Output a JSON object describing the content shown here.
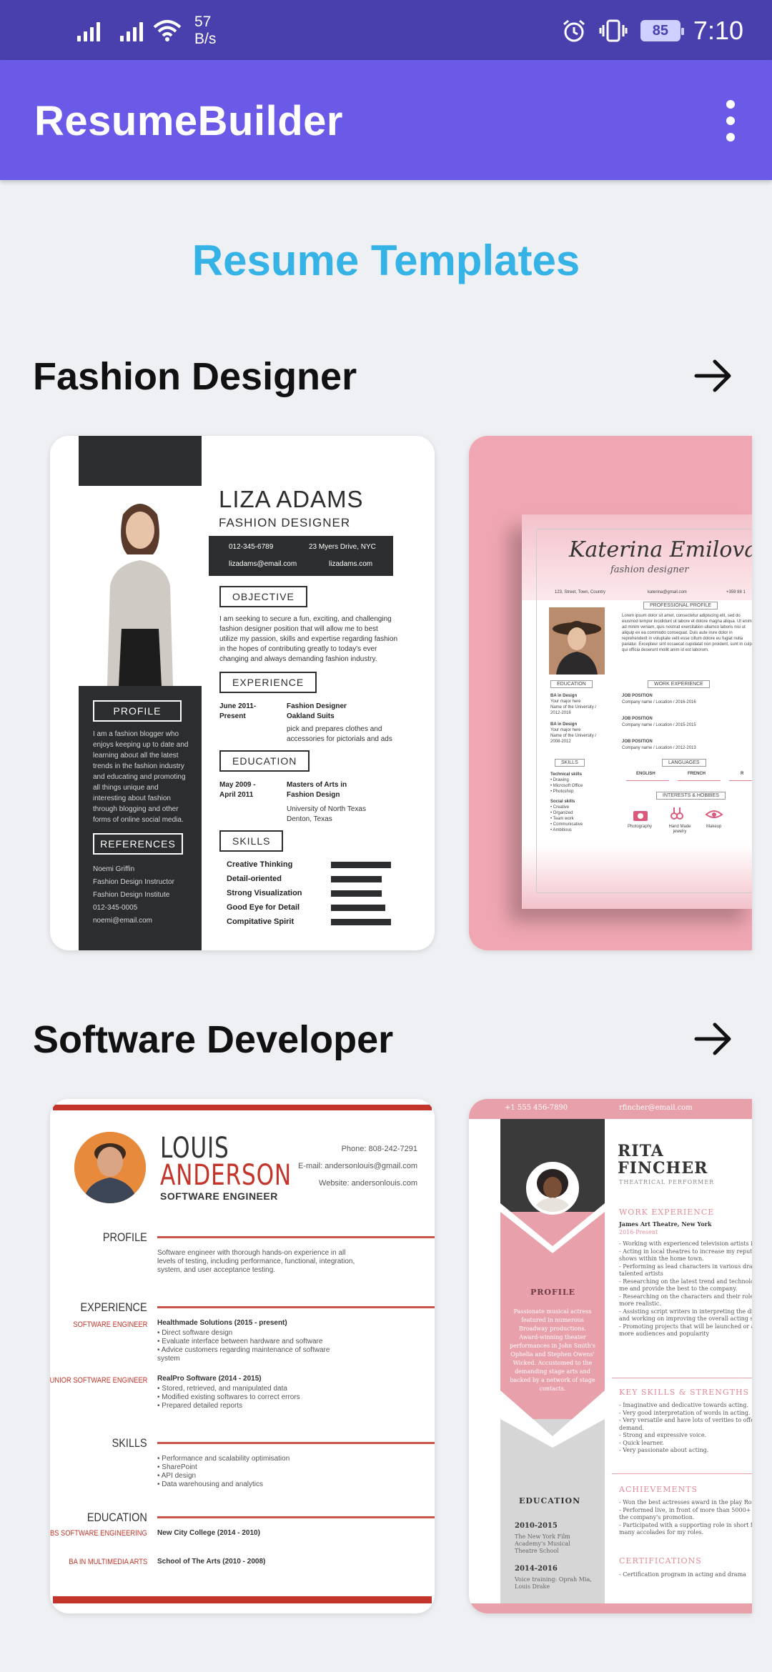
{
  "status_bar": {
    "net_speed_value": "57",
    "net_speed_unit": "B/s",
    "battery": "85",
    "time": "7:10"
  },
  "app_bar": {
    "title": "ResumeBuilder",
    "menu_icon": "more-vert-icon"
  },
  "page_heading": "Resume Templates",
  "accent_colors": {
    "status_bar": "#4a40ad",
    "app_bar": "#6b5ae8",
    "heading": "#35b3e6"
  },
  "sections": [
    {
      "title": "Fashion Designer",
      "arrow_icon": "arrow-right-icon",
      "templates": [
        {
          "name": "LIZA ADAMS",
          "role": "FASHION DESIGNER",
          "phone": "012-345-6789",
          "address": "23 Myers Drive, NYC",
          "email": "lizadams@email.com",
          "website": "lizadams.com",
          "objective_h": "OBJECTIVE",
          "objective": "I am seeking to secure a fun, exciting, and challenging fashion designer position that will allow me to best utilize my passion, skills and expertise regarding fashion in the hopes of contributing greatly to today's ever changing and always demanding fashion industry.",
          "experience_h": "EXPERIENCE",
          "exp_date": "June 2011-\nPresent",
          "exp_title": "Fashion Designer\nOakland Suits",
          "exp_desc": "pick and prepares clothes and accessories for pictorials and ads",
          "education_h": "EDUCATION",
          "edu_date": "May 2009 -\nApril 2011",
          "edu_title": "Masters of  Arts in\nFashion Design",
          "edu_school": "University of North Texas\nDenton, Texas",
          "skills_h": "SKILLS",
          "skills": [
            "Creative Thinking",
            "Detail-oriented",
            "Strong Visualization",
            "Good Eye for Detail",
            "Compitative Spirit"
          ],
          "skill_levels": [
            1.0,
            0.85,
            0.85,
            0.9,
            1.0
          ],
          "profile_h": "PROFILE",
          "profile": "I am a fashion blogger who enjoys keeping up to date and learning about all the latest trends in the fashion industry and educating and promoting all things unique and interesting about fashion through blogging and other forms of online social media.",
          "references_h": "REFERENCES",
          "references": [
            "Noemi Griffin",
            "Fashion Design Instructor",
            "Fashion Design Institute",
            "012-345-0005",
            "noemi@email.com"
          ]
        },
        {
          "name": "Katerina Emilova",
          "role": "fashion designer",
          "address": "123, Street, Town, Country",
          "email": "katerina@gmail.com",
          "phone": "+359 88 1",
          "profile_h": "PROFESSIONAL PROFILE",
          "profile": "Lorem ipsum dolor sit amet, consectetur adipiscing elit, sed do eiusmod tempor incididunt ut labore et dolore magna aliqua. Ut enim ad minim veniam, quis nostrud exercitation ullamco laboris nisi ut aliquip ex ea commodo consequat. Duis aute irure dolor in reprehenderit in voluptate velit esse cillum dolore eu fugiat nulla pariatur. Excepteur sint occaecat cupidatat non proident, sunt in culpa qui officia deserunt mollit anim id est laborum.",
          "education_h": "EDUCATION",
          "education": [
            "BA in Design",
            "Your major here",
            "Name of the University /",
            "2012-2016",
            "BA in Design",
            "Your major here",
            "Name of the University /",
            "2008-2012"
          ],
          "work_h": "WORK EXPERIENCE",
          "jobs": [
            "JOB POSITION",
            "Company name / Location / 2016-2016",
            "JOB POSITION",
            "Company name / Location / 2015-2015",
            "JOB POSITION",
            "Company name / Location / 2012-2013"
          ],
          "skills_h": "SKILLS",
          "tech_h": "Technical skills",
          "tech": [
            "• Drawing",
            "• Microsoft Office",
            "• Photoshop"
          ],
          "social_h": "Social skills",
          "social": [
            "• Creative",
            "• Organized",
            "• Team work",
            "• Communicative",
            "• Ambitious"
          ],
          "languages_h": "LANGUAGES",
          "languages": [
            "ENGLISH",
            "FRENCH",
            "R"
          ],
          "interests_h": "INTERESTS & HOBBIES",
          "interests": [
            "Photography",
            "Hand Made jewelry",
            "Makeup"
          ]
        }
      ]
    },
    {
      "title": "Software Developer",
      "arrow_icon": "arrow-right-icon",
      "templates": [
        {
          "first_name": "LOUIS",
          "last_name": "ANDERSON",
          "role": "SOFTWARE ENGINEER",
          "phone": "Phone: 808-242-7291",
          "email": "E-mail: andersonlouis@gmail.com",
          "website": "Website: andersonlouis.com",
          "profile_h": "PROFILE",
          "profile": "Software engineer with thorough hands-on experience in all levels of testing, including performance, functional, integration, system, and user acceptance testing.",
          "experience_h": "EXPERIENCE",
          "exp1_role": "SOFTWARE ENGINEER",
          "exp1_title": "Healthmade Solutions (2015 - present)",
          "exp1_items": "• Direct software design\n• Evaluate interface between hardware and software\n• Advice customers regarding maintenance of software\n  system",
          "exp2_role": "JUNIOR SOFTWARE\nENGINEER",
          "exp2_title": "RealPro Software (2014 - 2015)",
          "exp2_items": "• Stored, retrieved, and manipulated data\n• Modified existing softwares to correct errors\n• Prepared detailed reports",
          "skills_h": "SKILLS",
          "skills": "• Performance and scalability optimisation\n• SharePoint\n• API design\n• Data warehousing and analytics",
          "education_h": "EDUCATION",
          "edu1_degree": "BS SOFTWARE\nENGINEERING",
          "edu1_school": "New City College (2014 - 2010)",
          "edu2_degree": "BA IN MULTIMEDIA\nARTS",
          "edu2_school": "School of The Arts (2010 - 2008)"
        },
        {
          "phone": "+1 555 456-7890",
          "email": "rfincher@email.com",
          "first_name": "RITA",
          "last_name": "FINCHER",
          "role": "THEATRICAL PERFORMER",
          "profile_h": "PROFILE",
          "profile": "Passionate musical actress featured in numerous Broadway productions. Award-winning theater performances in John Smith's Ophelia and Stephen Owens' Wicked. Accustomed to the demanding stage arts and backed by a network of stage contacts.",
          "education_h": "EDUCATION",
          "edu1_years": "2010-2015",
          "edu1_school": "The New York Film Academy's Musical Theatre School",
          "edu2_years": "2014-2016",
          "edu2_school": "Voice training: Oprah Mia, Louis Drake",
          "work_h": "WORK EXPERIENCE",
          "work_place": "James Art Theatre, New York",
          "work_years": "2016-Present",
          "work_items": "- Working with experienced television artists in\n- Acting in local theatres to increase my reputation\nshows within the home town.\n- Performing as lead characters in various dramas\ntalented artists\n- Researching on the latest trend and technology\nme and provide the best to the company.\n- Researching on the characters and their roles\nmore realistic.\n- Assisting script writers in interpreting the dialogue\nand working on improving the overall acting style\n- Promoting projects that will be launched or already\nmore audiences and popularity",
          "skills_h": "KEY SKILLS & STRENGTHS",
          "skill_items": "- Imaginative and dedicative towards acting.\n- Very good interpretation of words in acting.\n- Very versatile and have lots of verities to offer\ndemand.\n- Strong and expressive voice.\n- Quick learner.\n- Very passionate about acting.",
          "achievements_h": "ACHIEVEMENTS",
          "achievement_items": "- Won the best actresses award in the play Romeo\n- Performed live, in front of more than 5000+ people\nthe company's promotion.\n- Participated with a supporting role in short film\nmany accolades for my roles.",
          "certifications_h": "CERTIFICATIONS",
          "certification_items": "- Certification program in acting and drama"
        }
      ]
    }
  ]
}
